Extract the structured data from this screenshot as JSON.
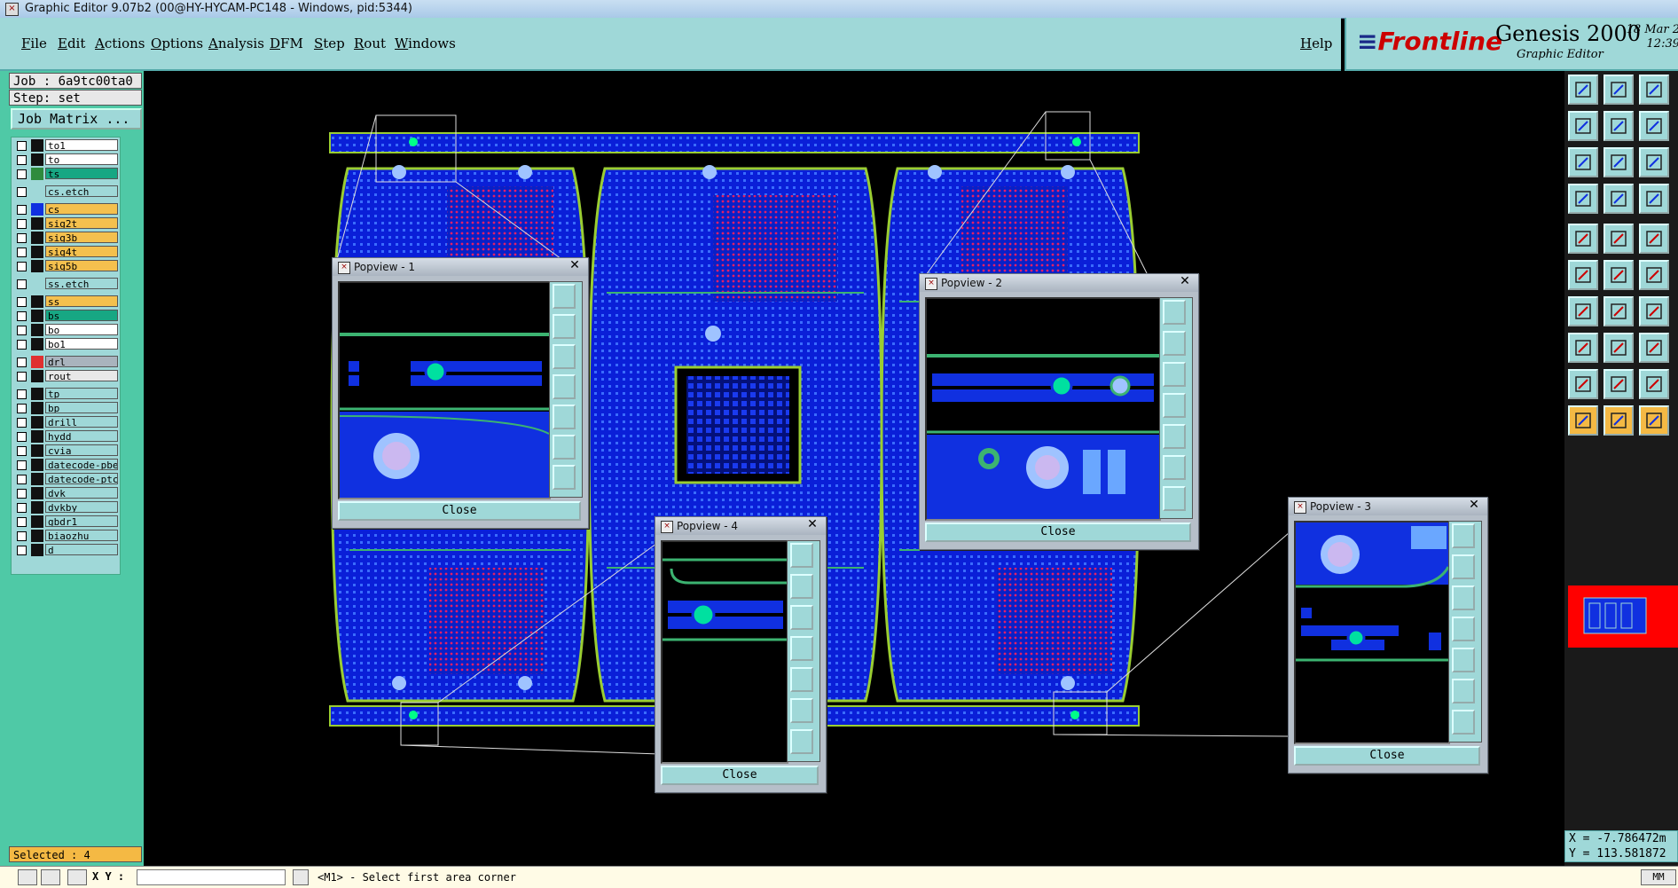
{
  "window": {
    "title": "Graphic Editor 9.07b2 (00@HY-HYCAM-PC148 - Windows, pid:5344)"
  },
  "menubar": {
    "items": [
      "File",
      "Edit",
      "Actions",
      "Options",
      "Analysis",
      "DFM",
      "Step",
      "Rout",
      "Windows"
    ],
    "help": "Help"
  },
  "brand": {
    "logo": "Frontline",
    "product": "Genesis 2000",
    "subtitle": "Graphic Editor",
    "date": "18 Mar 2",
    "time": "12:39"
  },
  "left_panel": {
    "job": "Job : 6a9tc00ta0",
    "step": "Step: set",
    "job_matrix_button": "Job Matrix ...",
    "layers": [
      {
        "name": "to1",
        "color": "#ffffff",
        "swatch": "#111111"
      },
      {
        "name": "to",
        "color": "#ffffff",
        "swatch": "#111111"
      },
      {
        "name": "ts",
        "color": "#17a783",
        "swatch": "#2e8b3e"
      },
      {
        "name": "cs.etch",
        "color": "#9fd8d8",
        "swatch": "#9fd8d8"
      },
      {
        "name": "cs",
        "color": "#f4c04e",
        "swatch": "#1030e0"
      },
      {
        "name": "sig2t",
        "color": "#f4c04e",
        "swatch": "#111111"
      },
      {
        "name": "sig3b",
        "color": "#f4c04e",
        "swatch": "#111111"
      },
      {
        "name": "sig4t",
        "color": "#f4c04e",
        "swatch": "#111111"
      },
      {
        "name": "sig5b",
        "color": "#f4c04e",
        "swatch": "#111111"
      },
      {
        "name": "ss.etch",
        "color": "#9fd8d8",
        "swatch": "#9fd8d8"
      },
      {
        "name": "ss",
        "color": "#f4c04e",
        "swatch": "#111111"
      },
      {
        "name": "bs",
        "color": "#17a783",
        "swatch": "#111111"
      },
      {
        "name": "bo",
        "color": "#ffffff",
        "swatch": "#111111"
      },
      {
        "name": "bo1",
        "color": "#ffffff",
        "swatch": "#111111"
      },
      {
        "name": "drl",
        "color": "#a9b3bd",
        "swatch": "#e03030"
      },
      {
        "name": "rout",
        "color": "#e8e8e8",
        "swatch": "#111111"
      },
      {
        "name": "tp",
        "color": "#9fd8d8",
        "swatch": "#111111"
      },
      {
        "name": "bp",
        "color": "#9fd8d8",
        "swatch": "#111111"
      },
      {
        "name": "drill",
        "color": "#9fd8d8",
        "swatch": "#111111"
      },
      {
        "name": "hydd",
        "color": "#9fd8d8",
        "swatch": "#111111"
      },
      {
        "name": "cvia",
        "color": "#9fd8d8",
        "swatch": "#111111"
      },
      {
        "name": "datecode-pbe",
        "color": "#9fd8d8",
        "swatch": "#111111"
      },
      {
        "name": "datecode-ptc",
        "color": "#9fd8d8",
        "swatch": "#111111"
      },
      {
        "name": "dvk",
        "color": "#9fd8d8",
        "swatch": "#111111"
      },
      {
        "name": "dvkby",
        "color": "#9fd8d8",
        "swatch": "#111111"
      },
      {
        "name": "gbdr1",
        "color": "#9fd8d8",
        "swatch": "#111111"
      },
      {
        "name": "biaozhu",
        "color": "#9fd8d8",
        "swatch": "#111111"
      },
      {
        "name": "d",
        "color": "#9fd8d8",
        "swatch": "#111111"
      }
    ],
    "selected": "Selected : 4"
  },
  "popviews": [
    {
      "title": "Popview - 1",
      "close": "Close"
    },
    {
      "title": "Popview - 2",
      "close": "Close"
    },
    {
      "title": "Popview - 3",
      "close": "Close"
    },
    {
      "title": "Popview - 4",
      "close": "Close"
    }
  ],
  "coords": {
    "x": "X = -7.786472m",
    "y": "Y = 113.581872"
  },
  "statusbar": {
    "xy_label": "X Y :",
    "xy_value": "",
    "message": "<M1> - Select first area corner",
    "unit": "MM"
  }
}
